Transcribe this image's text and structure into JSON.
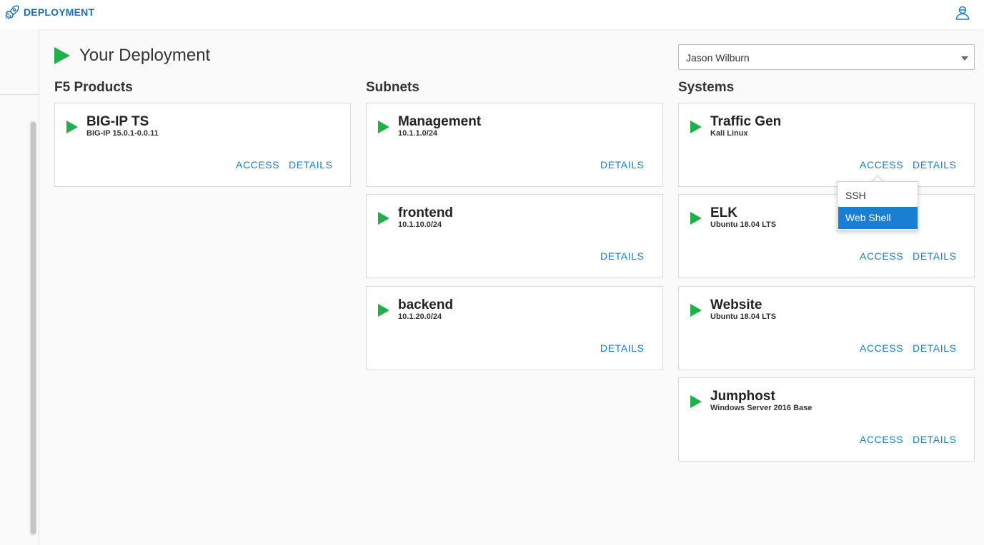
{
  "app": {
    "title": "DEPLOYMENT"
  },
  "page": {
    "title": "Your Deployment"
  },
  "user_select": {
    "value": "Jason Wilburn"
  },
  "columns": {
    "products": "F5 Products",
    "subnets": "Subnets",
    "systems": "Systems"
  },
  "products": [
    {
      "name": "BIG-IP TS",
      "sub": "BIG-IP 15.0.1-0.0.11",
      "access": "ACCESS",
      "details": "DETAILS"
    }
  ],
  "subnets": [
    {
      "name": "Management",
      "sub": "10.1.1.0/24",
      "details": "DETAILS"
    },
    {
      "name": "frontend",
      "sub": "10.1.10.0/24",
      "details": "DETAILS"
    },
    {
      "name": "backend",
      "sub": "10.1.20.0/24",
      "details": "DETAILS"
    }
  ],
  "systems": [
    {
      "name": "Traffic Gen",
      "sub": "Kali Linux",
      "access": "ACCESS",
      "details": "DETAILS"
    },
    {
      "name": "ELK",
      "sub": "Ubuntu 18.04 LTS",
      "access": "ACCESS",
      "details": "DETAILS"
    },
    {
      "name": "Website",
      "sub": "Ubuntu 18.04 LTS",
      "access": "ACCESS",
      "details": "DETAILS"
    },
    {
      "name": "Jumphost",
      "sub": "Windows Server 2016 Base",
      "access": "ACCESS",
      "details": "DETAILS"
    }
  ],
  "access_menu": {
    "items": [
      "SSH",
      "Web Shell"
    ],
    "highlighted": "Web Shell"
  },
  "icons": {
    "brand": "rocket-icon",
    "user": "user-account-icon",
    "status": "play-icon"
  },
  "colors": {
    "accent": "#1b7dc7",
    "status_green": "#1fb04a",
    "menu_highlight": "#1a7fd4"
  }
}
